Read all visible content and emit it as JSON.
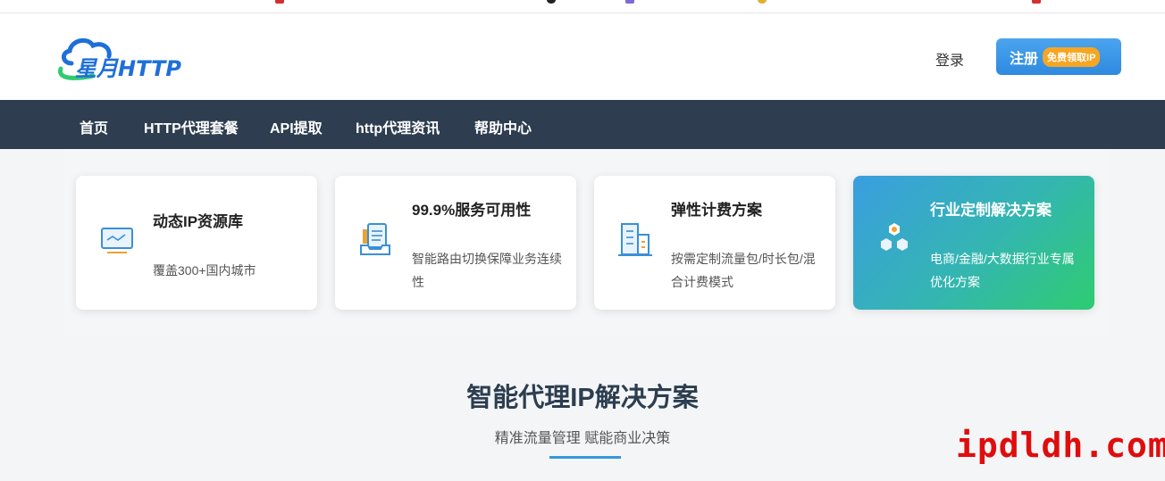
{
  "header": {
    "logo_text": "星月HTTP",
    "login_label": "登录",
    "register_label": "注册",
    "register_badge": "免费领取IP"
  },
  "nav": {
    "items": [
      {
        "label": "首页"
      },
      {
        "label": "HTTP代理套餐"
      },
      {
        "label": "API提取"
      },
      {
        "label": "http代理资讯"
      },
      {
        "label": "帮助中心"
      }
    ]
  },
  "features": [
    {
      "title": "动态IP资源库",
      "desc": "覆盖300+国内城市",
      "icon": "monitor-icon"
    },
    {
      "title": "99.9%服务可用性",
      "desc": "智能路由切换保障业务连续性",
      "icon": "document-tray-icon"
    },
    {
      "title": "弹性计费方案",
      "desc": "按需定制流量包/时长包/混合计费模式",
      "icon": "building-icon"
    },
    {
      "title": "行业定制解决方案",
      "desc": "电商/金融/大数据行业专属优化方案",
      "icon": "hexagons-icon"
    }
  ],
  "section": {
    "title": "智能代理IP解决方案",
    "subtitle": "精准流量管理 赋能商业决策"
  },
  "watermark": "ipdldh.com",
  "colors": {
    "nav_bg": "#2e3e50",
    "accent": "#3498db",
    "badge": "#f6a623",
    "watermark": "#e00d0d"
  }
}
